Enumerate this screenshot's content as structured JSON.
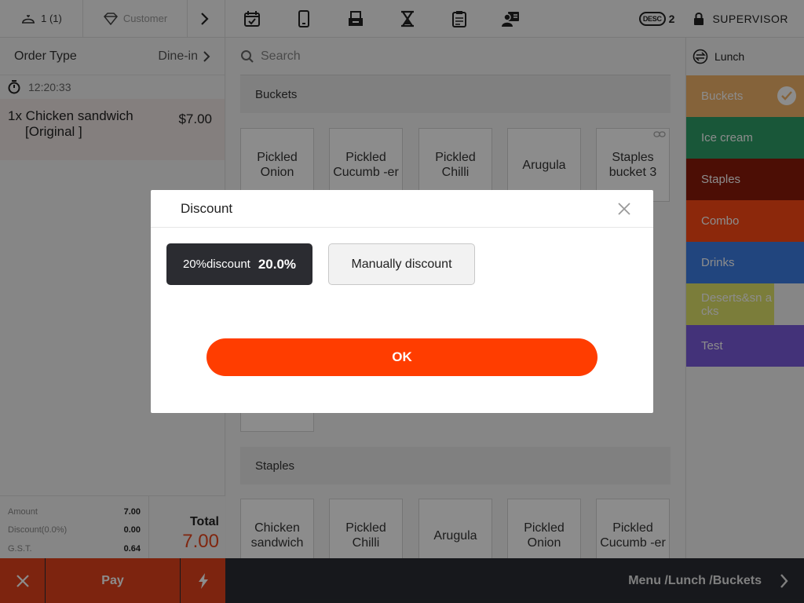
{
  "topbar": {
    "table_label": "1 (1)",
    "customer_label": "Customer",
    "desc_badge": "DESC",
    "desc_count": "2",
    "supervisor_label": "SUPERVISOR",
    "tool_icons": [
      "calendar-check-icon",
      "phone-icon",
      "cash-drawer-icon",
      "hourglass-icon",
      "clipboard-icon",
      "user-card-icon"
    ]
  },
  "order": {
    "type_label": "Order Type",
    "type_value": "Dine-in",
    "timer": "12:20:33",
    "items": [
      {
        "qty_name": "1x Chicken sandwich",
        "modifier": "[Original ]",
        "price": "$7.00"
      }
    ]
  },
  "summary": {
    "rows": [
      {
        "label": "Amount",
        "value": "7.00"
      },
      {
        "label": "Discount(0.0%)",
        "value": "0.00"
      },
      {
        "label": "G.S.T.",
        "value": "0.64"
      }
    ],
    "total_label": "Total",
    "total_value": "7.00"
  },
  "bottombar": {
    "pay_label": "Pay",
    "path": "Menu /Lunch /Buckets"
  },
  "middle": {
    "search_placeholder": "Search",
    "sections": [
      {
        "title": "Buckets",
        "items": [
          "Pickled Onion",
          "Pickled Cucumb -er",
          "Pickled Chilli",
          "Arugula",
          "Staples bucket  3"
        ]
      },
      {
        "title": "Staples",
        "items": [
          "Chicken sandwich",
          "Pickled Chilli",
          "Arugula",
          "Pickled Onion",
          "Pickled Cucumb -er"
        ]
      }
    ]
  },
  "menu": {
    "title": "Lunch",
    "categories": [
      {
        "label": "Buckets",
        "color": "#f2b46a",
        "selected": true
      },
      {
        "label": "Ice cream",
        "color": "#2f9f69"
      },
      {
        "label": "Staples",
        "color": "#8b1a0a"
      },
      {
        "label": "Combo",
        "color": "#ff4a14"
      },
      {
        "label": "Drinks",
        "color": "#3d7fe6"
      },
      {
        "label": "Deserts&sn acks",
        "color": "#e1e36a"
      },
      {
        "label": "Test",
        "color": "#7b5bdc"
      }
    ]
  },
  "dialog": {
    "title": "Discount",
    "options": [
      {
        "name": "20%discount",
        "value": "20.0%",
        "selected": true
      },
      {
        "name": "Manually discount",
        "selected": false
      }
    ],
    "ok_label": "OK"
  },
  "colors": {
    "accent": "#ff3d00",
    "pay": "#e4431c",
    "bottom_bar": "#2a2d33",
    "selected_option": "#2b2c31"
  }
}
